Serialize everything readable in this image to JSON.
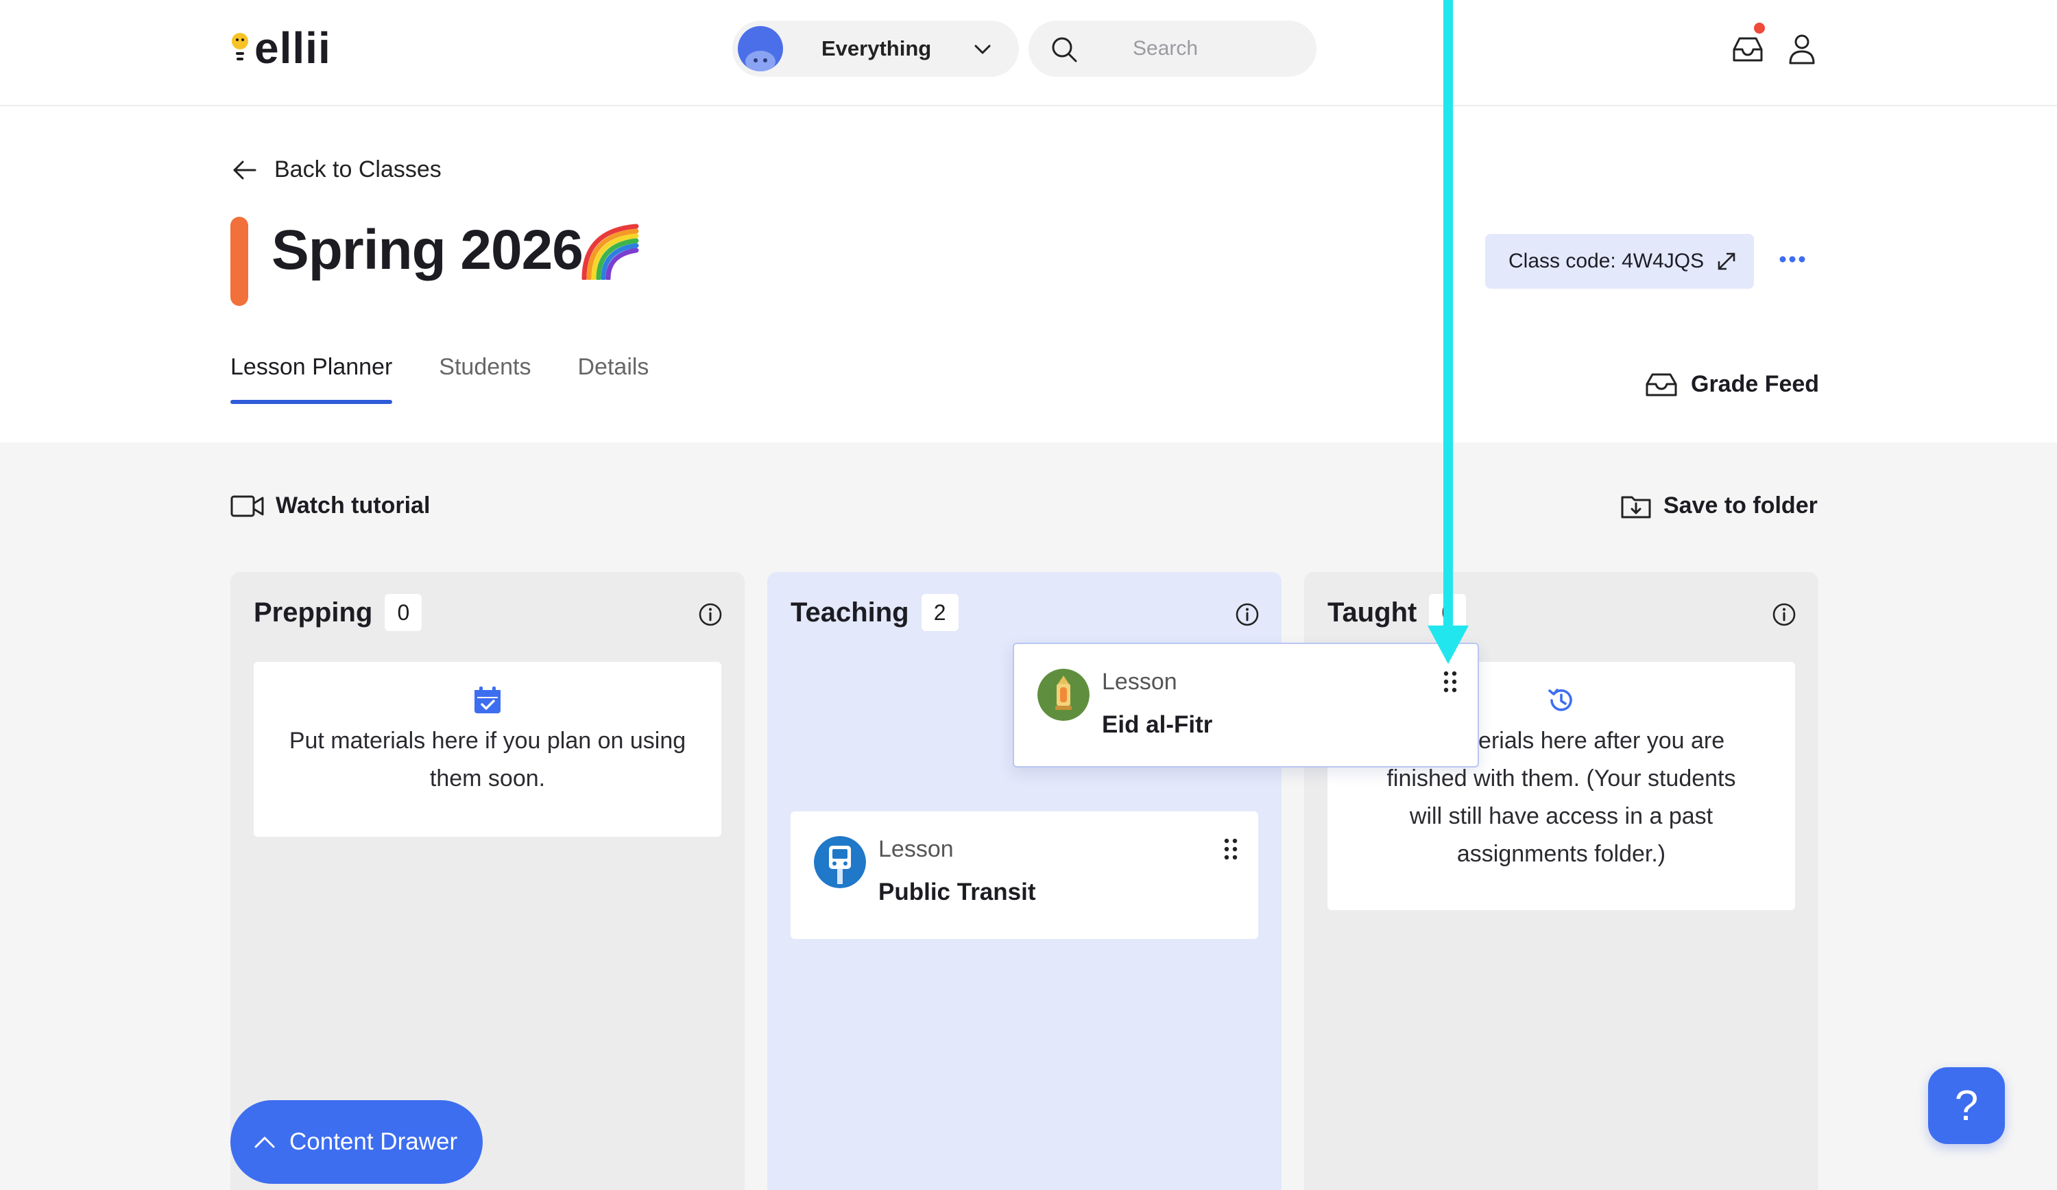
{
  "header": {
    "logo_text": "ellii",
    "filter_label": "Everything",
    "search_placeholder": "Search"
  },
  "class": {
    "back_label": "Back to Classes",
    "title": "Spring 2026",
    "class_code_label": "Class code: 4W4JQS"
  },
  "tabs": [
    {
      "label": "Lesson Planner",
      "active": true
    },
    {
      "label": "Students",
      "active": false
    },
    {
      "label": "Details",
      "active": false
    }
  ],
  "actions": {
    "grade_feed": "Grade Feed",
    "watch_tutorial": "Watch tutorial",
    "save_to_folder": "Save to folder",
    "content_drawer": "Content Drawer",
    "help": "?"
  },
  "columns": [
    {
      "title": "Prepping",
      "count": "0",
      "placeholder": "Put materials here if you plan on using them soon."
    },
    {
      "title": "Teaching",
      "count": "2"
    },
    {
      "title": "Taught",
      "count": "0",
      "placeholder": "Put materials here after you are finished with them. (Your students will still have access in a past assignments folder.)"
    }
  ],
  "cards": {
    "dragging": {
      "type": "Lesson",
      "name": "Eid al-Fitr"
    },
    "transit": {
      "type": "Lesson",
      "name": "Public Transit"
    }
  },
  "colors": {
    "accent": "#3d6ef0",
    "title_bar": "#f2703a",
    "teaching_column": "#e3e8fb",
    "arrow": "#22e6ee"
  },
  "icons": [
    "lightbulb-icon",
    "chevron-down-icon",
    "search-icon",
    "inbox-icon",
    "user-icon",
    "arrow-left-icon",
    "rainbow-icon",
    "expand-icon",
    "more-icon",
    "video-icon",
    "folder-download-icon",
    "info-icon",
    "calendar-check-icon",
    "history-icon",
    "drag-handle-icon",
    "chevron-up-icon"
  ]
}
